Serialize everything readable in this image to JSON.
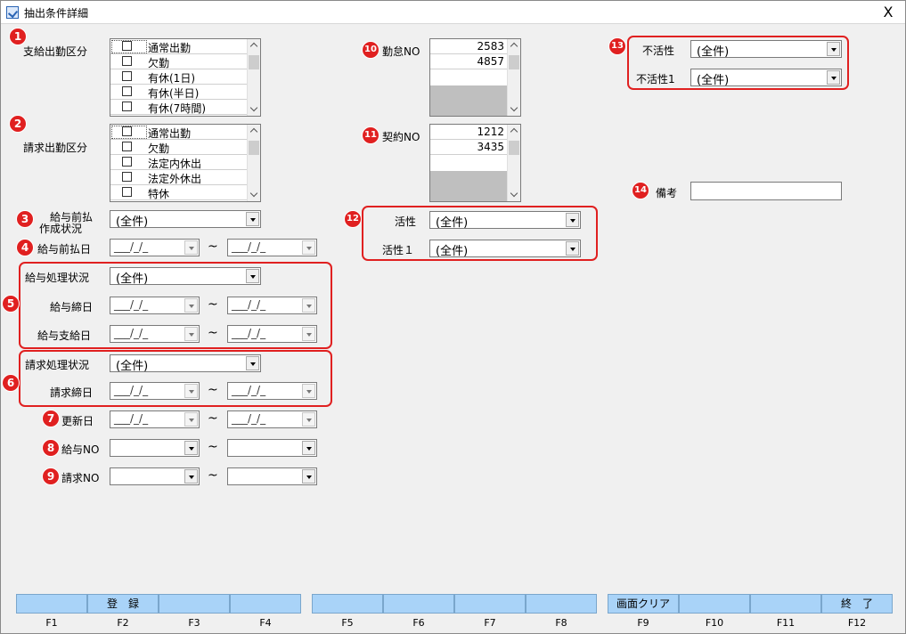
{
  "window": {
    "title": "抽出条件詳細",
    "close_glyph": "X"
  },
  "badges": [
    "1",
    "2",
    "3",
    "4",
    "5",
    "6",
    "7",
    "8",
    "9",
    "10",
    "11",
    "12",
    "13",
    "14"
  ],
  "section1": {
    "label": "支給出勤区分",
    "items": [
      "通常出勤",
      "欠勤",
      "有休(1日)",
      "有休(半日)",
      "有休(7時間)"
    ]
  },
  "section2": {
    "label": "請求出勤区分",
    "items": [
      "通常出勤",
      "欠勤",
      "法定内休出",
      "法定外休出",
      "特休"
    ]
  },
  "kyuyo_maebarai_status": {
    "label_line1": "給与前払",
    "label_line2": "作成状況",
    "value": "(全件)"
  },
  "kyuyo_maebarai_date": {
    "label": "給与前払日",
    "from": "___/_/_",
    "to": "___/_/_"
  },
  "kyuyo_process": {
    "label": "給与処理状況",
    "value": "(全件)"
  },
  "kyuyo_shime": {
    "label": "給与締日",
    "from": "___/_/_",
    "to": "___/_/_"
  },
  "kyuyo_shikyu": {
    "label": "給与支給日",
    "from": "___/_/_",
    "to": "___/_/_"
  },
  "seikyu_process": {
    "label": "請求処理状況",
    "value": "(全件)"
  },
  "seikyu_shime": {
    "label": "請求締日",
    "from": "___/_/_",
    "to": "___/_/_"
  },
  "koshin": {
    "label": "更新日",
    "from": "___/_/_",
    "to": "___/_/_"
  },
  "kyuyo_no": {
    "label": "給与NO",
    "from": "",
    "to": ""
  },
  "seikyu_no": {
    "label": "請求NO",
    "from": "",
    "to": ""
  },
  "range_sep": "~",
  "kintai_no": {
    "label": "勤怠NO",
    "values": [
      "2583",
      "4857"
    ]
  },
  "keiyaku_no": {
    "label": "契約NO",
    "values": [
      "1212",
      "3435"
    ]
  },
  "kassei": {
    "label": "活性",
    "value": "(全件)"
  },
  "kassei1": {
    "label": "活性１",
    "value": "(全件)"
  },
  "fukassei": {
    "label": "不活性",
    "value": "(全件)"
  },
  "fukassei1": {
    "label": "不活性1",
    "value": "(全件)"
  },
  "biko": {
    "label": "備考",
    "value": ""
  },
  "fkeys": [
    {
      "key": "F1",
      "label": ""
    },
    {
      "key": "F2",
      "label": "登　録"
    },
    {
      "key": "F3",
      "label": ""
    },
    {
      "key": "F4",
      "label": ""
    },
    {
      "key": "F5",
      "label": ""
    },
    {
      "key": "F6",
      "label": ""
    },
    {
      "key": "F7",
      "label": ""
    },
    {
      "key": "F8",
      "label": ""
    },
    {
      "key": "F9",
      "label": "画面クリア"
    },
    {
      "key": "F10",
      "label": ""
    },
    {
      "key": "F11",
      "label": ""
    },
    {
      "key": "F12",
      "label": "終　了"
    }
  ],
  "colors": {
    "badge": "#e02020",
    "fkey": "#a9d3f8",
    "gray_area": "#bfbfbf"
  }
}
